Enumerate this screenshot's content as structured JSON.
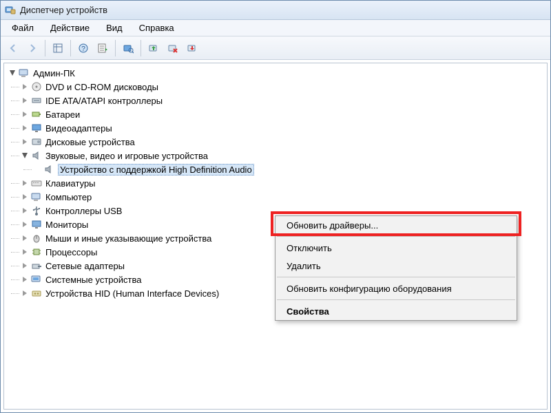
{
  "window": {
    "title": "Диспетчер устройств"
  },
  "menubar": {
    "file": "Файл",
    "action": "Действие",
    "view": "Вид",
    "help": "Справка"
  },
  "toolbar": {
    "back": "back",
    "forward": "forward",
    "properties": "properties",
    "help": "help",
    "refresh": "refresh",
    "scan": "scan",
    "update_driver": "update-driver",
    "uninstall": "uninstall",
    "disable": "disable"
  },
  "tree": {
    "root": {
      "label": "Админ-ПК"
    },
    "items": [
      {
        "label": "DVD и CD-ROM дисководы",
        "icon": "cd"
      },
      {
        "label": "IDE ATA/ATAPI контроллеры",
        "icon": "ide"
      },
      {
        "label": "Батареи",
        "icon": "battery"
      },
      {
        "label": "Видеоадаптеры",
        "icon": "display"
      },
      {
        "label": "Дисковые устройства",
        "icon": "disk"
      },
      {
        "label": "Звуковые, видео и игровые устройства",
        "icon": "sound",
        "expanded": true,
        "children": [
          {
            "label": "Устройство с поддержкой High Definition Audio",
            "selected": true
          }
        ]
      },
      {
        "label": "Клавиатуры",
        "icon": "keyboard"
      },
      {
        "label": "Компьютер",
        "icon": "computer"
      },
      {
        "label": "Контроллеры USB",
        "icon": "usb"
      },
      {
        "label": "Мониторы",
        "icon": "monitor"
      },
      {
        "label": "Мыши и иные указывающие устройства",
        "icon": "mouse"
      },
      {
        "label": "Процессоры",
        "icon": "cpu"
      },
      {
        "label": "Сетевые адаптеры",
        "icon": "network"
      },
      {
        "label": "Системные устройства",
        "icon": "system"
      },
      {
        "label": "Устройства HID (Human Interface Devices)",
        "icon": "hid"
      }
    ]
  },
  "context_menu": {
    "update_drivers": "Обновить драйверы...",
    "disable": "Отключить",
    "delete": "Удалить",
    "scan_hardware": "Обновить конфигурацию оборудования",
    "properties": "Свойства"
  }
}
